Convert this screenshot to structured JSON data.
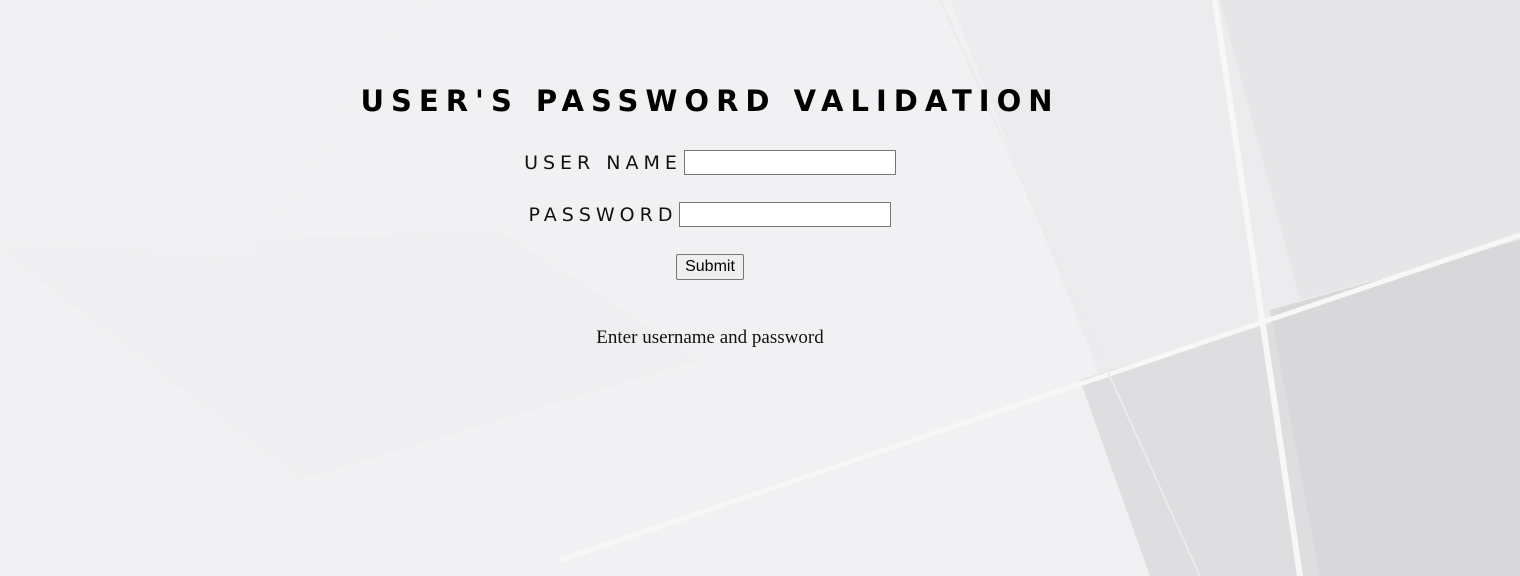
{
  "page": {
    "title": "USER'S PASSWORD VALIDATION"
  },
  "form": {
    "username_label": "USER NAME",
    "username_value": "",
    "password_label": "PASSWORD",
    "password_value": "",
    "submit_label": "Submit"
  },
  "status": {
    "message": "Enter username and password"
  },
  "colors": {
    "background": "#f1f1f3",
    "text": "#000000"
  }
}
